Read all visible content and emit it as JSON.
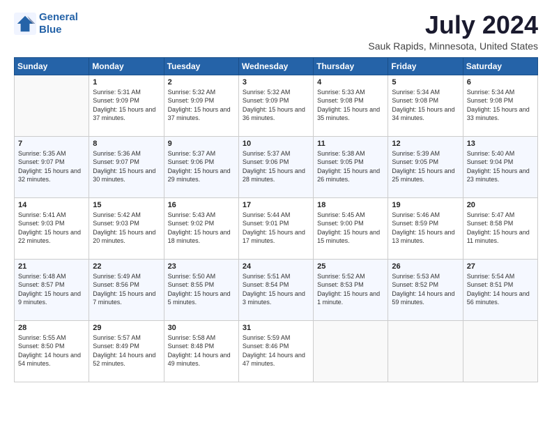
{
  "header": {
    "logo_line1": "General",
    "logo_line2": "Blue",
    "main_title": "July 2024",
    "subtitle": "Sauk Rapids, Minnesota, United States"
  },
  "calendar": {
    "days_of_week": [
      "Sunday",
      "Monday",
      "Tuesday",
      "Wednesday",
      "Thursday",
      "Friday",
      "Saturday"
    ],
    "weeks": [
      [
        {
          "day": "",
          "sunrise": "",
          "sunset": "",
          "daylight": ""
        },
        {
          "day": "1",
          "sunrise": "Sunrise: 5:31 AM",
          "sunset": "Sunset: 9:09 PM",
          "daylight": "Daylight: 15 hours and 37 minutes."
        },
        {
          "day": "2",
          "sunrise": "Sunrise: 5:32 AM",
          "sunset": "Sunset: 9:09 PM",
          "daylight": "Daylight: 15 hours and 37 minutes."
        },
        {
          "day": "3",
          "sunrise": "Sunrise: 5:32 AM",
          "sunset": "Sunset: 9:09 PM",
          "daylight": "Daylight: 15 hours and 36 minutes."
        },
        {
          "day": "4",
          "sunrise": "Sunrise: 5:33 AM",
          "sunset": "Sunset: 9:08 PM",
          "daylight": "Daylight: 15 hours and 35 minutes."
        },
        {
          "day": "5",
          "sunrise": "Sunrise: 5:34 AM",
          "sunset": "Sunset: 9:08 PM",
          "daylight": "Daylight: 15 hours and 34 minutes."
        },
        {
          "day": "6",
          "sunrise": "Sunrise: 5:34 AM",
          "sunset": "Sunset: 9:08 PM",
          "daylight": "Daylight: 15 hours and 33 minutes."
        }
      ],
      [
        {
          "day": "7",
          "sunrise": "Sunrise: 5:35 AM",
          "sunset": "Sunset: 9:07 PM",
          "daylight": "Daylight: 15 hours and 32 minutes."
        },
        {
          "day": "8",
          "sunrise": "Sunrise: 5:36 AM",
          "sunset": "Sunset: 9:07 PM",
          "daylight": "Daylight: 15 hours and 30 minutes."
        },
        {
          "day": "9",
          "sunrise": "Sunrise: 5:37 AM",
          "sunset": "Sunset: 9:06 PM",
          "daylight": "Daylight: 15 hours and 29 minutes."
        },
        {
          "day": "10",
          "sunrise": "Sunrise: 5:37 AM",
          "sunset": "Sunset: 9:06 PM",
          "daylight": "Daylight: 15 hours and 28 minutes."
        },
        {
          "day": "11",
          "sunrise": "Sunrise: 5:38 AM",
          "sunset": "Sunset: 9:05 PM",
          "daylight": "Daylight: 15 hours and 26 minutes."
        },
        {
          "day": "12",
          "sunrise": "Sunrise: 5:39 AM",
          "sunset": "Sunset: 9:05 PM",
          "daylight": "Daylight: 15 hours and 25 minutes."
        },
        {
          "day": "13",
          "sunrise": "Sunrise: 5:40 AM",
          "sunset": "Sunset: 9:04 PM",
          "daylight": "Daylight: 15 hours and 23 minutes."
        }
      ],
      [
        {
          "day": "14",
          "sunrise": "Sunrise: 5:41 AM",
          "sunset": "Sunset: 9:03 PM",
          "daylight": "Daylight: 15 hours and 22 minutes."
        },
        {
          "day": "15",
          "sunrise": "Sunrise: 5:42 AM",
          "sunset": "Sunset: 9:03 PM",
          "daylight": "Daylight: 15 hours and 20 minutes."
        },
        {
          "day": "16",
          "sunrise": "Sunrise: 5:43 AM",
          "sunset": "Sunset: 9:02 PM",
          "daylight": "Daylight: 15 hours and 18 minutes."
        },
        {
          "day": "17",
          "sunrise": "Sunrise: 5:44 AM",
          "sunset": "Sunset: 9:01 PM",
          "daylight": "Daylight: 15 hours and 17 minutes."
        },
        {
          "day": "18",
          "sunrise": "Sunrise: 5:45 AM",
          "sunset": "Sunset: 9:00 PM",
          "daylight": "Daylight: 15 hours and 15 minutes."
        },
        {
          "day": "19",
          "sunrise": "Sunrise: 5:46 AM",
          "sunset": "Sunset: 8:59 PM",
          "daylight": "Daylight: 15 hours and 13 minutes."
        },
        {
          "day": "20",
          "sunrise": "Sunrise: 5:47 AM",
          "sunset": "Sunset: 8:58 PM",
          "daylight": "Daylight: 15 hours and 11 minutes."
        }
      ],
      [
        {
          "day": "21",
          "sunrise": "Sunrise: 5:48 AM",
          "sunset": "Sunset: 8:57 PM",
          "daylight": "Daylight: 15 hours and 9 minutes."
        },
        {
          "day": "22",
          "sunrise": "Sunrise: 5:49 AM",
          "sunset": "Sunset: 8:56 PM",
          "daylight": "Daylight: 15 hours and 7 minutes."
        },
        {
          "day": "23",
          "sunrise": "Sunrise: 5:50 AM",
          "sunset": "Sunset: 8:55 PM",
          "daylight": "Daylight: 15 hours and 5 minutes."
        },
        {
          "day": "24",
          "sunrise": "Sunrise: 5:51 AM",
          "sunset": "Sunset: 8:54 PM",
          "daylight": "Daylight: 15 hours and 3 minutes."
        },
        {
          "day": "25",
          "sunrise": "Sunrise: 5:52 AM",
          "sunset": "Sunset: 8:53 PM",
          "daylight": "Daylight: 15 hours and 1 minute."
        },
        {
          "day": "26",
          "sunrise": "Sunrise: 5:53 AM",
          "sunset": "Sunset: 8:52 PM",
          "daylight": "Daylight: 14 hours and 59 minutes."
        },
        {
          "day": "27",
          "sunrise": "Sunrise: 5:54 AM",
          "sunset": "Sunset: 8:51 PM",
          "daylight": "Daylight: 14 hours and 56 minutes."
        }
      ],
      [
        {
          "day": "28",
          "sunrise": "Sunrise: 5:55 AM",
          "sunset": "Sunset: 8:50 PM",
          "daylight": "Daylight: 14 hours and 54 minutes."
        },
        {
          "day": "29",
          "sunrise": "Sunrise: 5:57 AM",
          "sunset": "Sunset: 8:49 PM",
          "daylight": "Daylight: 14 hours and 52 minutes."
        },
        {
          "day": "30",
          "sunrise": "Sunrise: 5:58 AM",
          "sunset": "Sunset: 8:48 PM",
          "daylight": "Daylight: 14 hours and 49 minutes."
        },
        {
          "day": "31",
          "sunrise": "Sunrise: 5:59 AM",
          "sunset": "Sunset: 8:46 PM",
          "daylight": "Daylight: 14 hours and 47 minutes."
        },
        {
          "day": "",
          "sunrise": "",
          "sunset": "",
          "daylight": ""
        },
        {
          "day": "",
          "sunrise": "",
          "sunset": "",
          "daylight": ""
        },
        {
          "day": "",
          "sunrise": "",
          "sunset": "",
          "daylight": ""
        }
      ]
    ]
  }
}
